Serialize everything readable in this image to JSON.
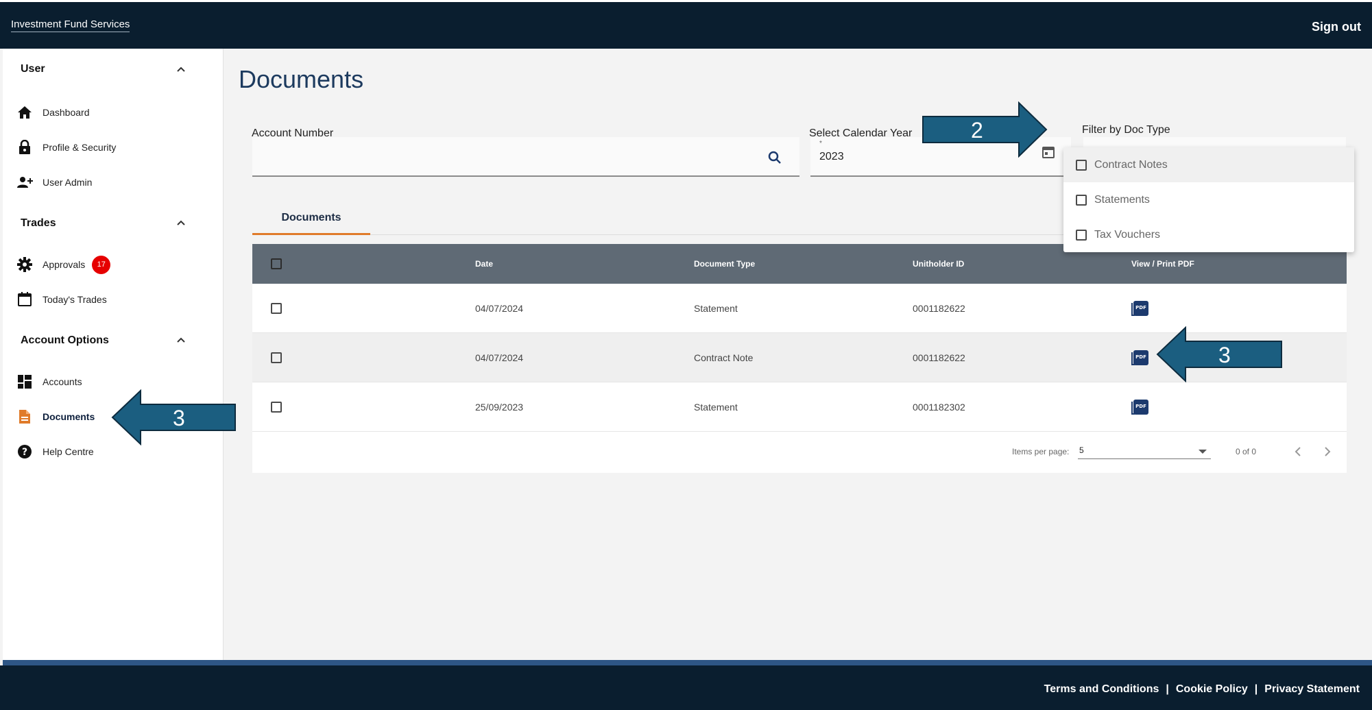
{
  "header": {
    "brand": "Investment Fund Services",
    "sign_out": "Sign out"
  },
  "sidebar": {
    "sections": [
      {
        "title": "User",
        "items": [
          {
            "label": "Dashboard",
            "icon": "home-icon"
          },
          {
            "label": "Profile & Security",
            "icon": "lock-icon"
          },
          {
            "label": "User Admin",
            "icon": "add-user-icon"
          }
        ]
      },
      {
        "title": "Trades",
        "items": [
          {
            "label": "Approvals",
            "icon": "gear-icon",
            "badge": "17"
          },
          {
            "label": "Today's Trades",
            "icon": "calendar-icon"
          }
        ]
      },
      {
        "title": "Account Options",
        "items": [
          {
            "label": "Accounts",
            "icon": "dashboard-grid-icon"
          },
          {
            "label": "Documents",
            "icon": "document-icon",
            "active": true
          },
          {
            "label": "Help Centre",
            "icon": "help-icon"
          }
        ]
      }
    ]
  },
  "main": {
    "title": "Documents",
    "filters": {
      "account_number_label": "Account Number",
      "account_number_value": "",
      "calendar_year_label": "Select Calendar Year",
      "calendar_year_required": "*",
      "calendar_year_value": "2023",
      "doc_type_label": "Filter by Doc Type"
    },
    "tab": "Documents",
    "table": {
      "headers": {
        "date": "Date",
        "doc_type": "Document Type",
        "unitholder": "Unitholder ID",
        "pdf": "View / Print PDF"
      },
      "rows": [
        {
          "date": "04/07/2024",
          "doc_type": "Statement",
          "unitholder": "0001182622"
        },
        {
          "date": "04/07/2024",
          "doc_type": "Contract Note",
          "unitholder": "0001182622"
        },
        {
          "date": "25/09/2023",
          "doc_type": "Statement",
          "unitholder": "0001182302"
        }
      ],
      "pdf_icon_text": "PDF"
    },
    "paginator": {
      "items_per_page_label": "Items per page:",
      "page_size": "5",
      "range": "0 of 0"
    }
  },
  "dropdown": {
    "options": [
      "Contract Notes",
      "Statements",
      "Tax Vouchers"
    ]
  },
  "annotations": {
    "arrow_filter": "2",
    "arrow_pdf": "3",
    "arrow_documents": "3"
  },
  "footer": {
    "links": [
      "Terms and Conditions",
      "Cookie Policy",
      "Privacy Statement"
    ],
    "separator": "|"
  },
  "colors": {
    "header_bg": "#0a1e2f",
    "accent_orange": "#e07b2a",
    "badge_red": "#e60000",
    "table_header": "#5f6a75",
    "arrow_fill": "#1b5e80",
    "title_blue": "#1c3a5e"
  }
}
